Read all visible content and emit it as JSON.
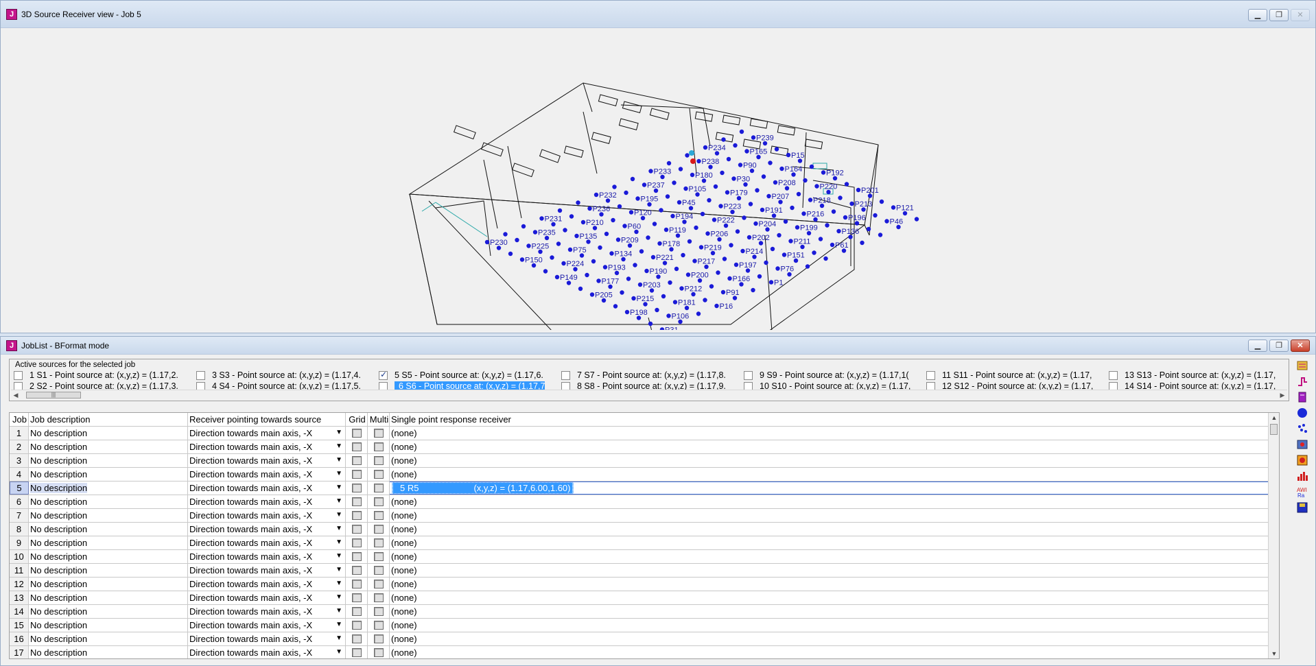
{
  "view_window": {
    "title": "3D Source Receiver view - Job 5",
    "icon": "app-logo-icon",
    "receiver_labels": [
      "P230",
      "P231",
      "P232",
      "P233",
      "P234",
      "P235",
      "P236",
      "P237",
      "P238",
      "P239",
      "P225",
      "P210",
      "P195",
      "P180",
      "P165",
      "P150",
      "P135",
      "P120",
      "P105",
      "P90",
      "P75",
      "P60",
      "P45",
      "P30",
      "P15",
      "P224",
      "P209",
      "P194",
      "P179",
      "P164",
      "P149",
      "P134",
      "P119",
      "P223",
      "P208",
      "P193",
      "P178",
      "P222",
      "P207",
      "P192",
      "P177",
      "P221",
      "P206",
      "P191",
      "P220",
      "P205",
      "P190",
      "P219",
      "P204",
      "P218",
      "P203",
      "P217",
      "P202",
      "P216",
      "P201",
      "P215",
      "P200",
      "P214",
      "P199",
      "P213",
      "P198",
      "P212",
      "P197",
      "P211",
      "P196",
      "P181",
      "P166",
      "P151",
      "P136",
      "P121",
      "P106",
      "P91",
      "P76",
      "P61",
      "P46",
      "P31",
      "P16",
      "P1"
    ]
  },
  "job_window": {
    "title": "JobList - BFormat mode",
    "icon": "app-logo-icon",
    "sources_caption": "Active sources for the selected job",
    "sources_row1": [
      {
        "label": "1 S1  -  Point source at: (x,y,z) = (1.17,2.",
        "checked": false,
        "selected": false
      },
      {
        "label": "3 S3  -  Point source at: (x,y,z) = (1.17,4.",
        "checked": false,
        "selected": false
      },
      {
        "label": "5 S5  -  Point source at: (x,y,z) = (1.17,6.",
        "checked": true,
        "selected": false
      },
      {
        "label": "7 S7  -  Point source at: (x,y,z) = (1.17,8.",
        "checked": false,
        "selected": false
      },
      {
        "label": "9 S9  -  Point source at: (x,y,z) = (1.17,1(",
        "checked": false,
        "selected": false
      },
      {
        "label": "11 S11  -  Point source at: (x,y,z) = (1.17,",
        "checked": false,
        "selected": false
      },
      {
        "label": "13 S13  -  Point source at: (x,y,z) = (1.17,",
        "checked": false,
        "selected": false
      }
    ],
    "sources_row2": [
      {
        "label": "2 S2  -  Point source at: (x,y,z) = (1.17,3.",
        "checked": false,
        "selected": false
      },
      {
        "label": "4 S4  -  Point source at: (x,y,z) = (1.17,5.",
        "checked": false,
        "selected": false
      },
      {
        "label": "6 S6  -  Point source at: (x,y,z) = (1.17,7",
        "checked": false,
        "selected": true
      },
      {
        "label": "8 S8  -  Point source at: (x,y,z) = (1.17,9.",
        "checked": false,
        "selected": false
      },
      {
        "label": "10 S10  -  Point source at: (x,y,z) = (1.17,",
        "checked": false,
        "selected": false
      },
      {
        "label": "12 S12  -  Point source at: (x,y,z) = (1.17,",
        "checked": false,
        "selected": false
      },
      {
        "label": "14 S14  -  Point source at: (x,y,z) = (1.17,",
        "checked": false,
        "selected": false
      }
    ],
    "grid": {
      "headers": {
        "job": "Job",
        "description": "Job description",
        "receiver": "Receiver pointing towards source",
        "grid": "Grid",
        "multi": "Multi",
        "single": "Single point response receiver"
      },
      "rows": [
        {
          "job": "1",
          "description": "No description",
          "receiver": "Direction towards main axis, -X",
          "single": "(none)"
        },
        {
          "job": "2",
          "description": "No description",
          "receiver": "Direction towards main axis, -X",
          "single": "(none)"
        },
        {
          "job": "3",
          "description": "No description",
          "receiver": "Direction towards main axis, -X",
          "single": "(none)"
        },
        {
          "job": "4",
          "description": "No description",
          "receiver": "Direction towards main axis, -X",
          "single": "(none)"
        },
        {
          "job": "5",
          "description": "No description",
          "receiver": "Direction towards main axis, -X",
          "single": "5 R5",
          "single_extra": "(x,y,z) = (1.17,6.00,1.60)",
          "selected": true
        },
        {
          "job": "6",
          "description": "No description",
          "receiver": "Direction towards main axis, -X",
          "single": "(none)"
        },
        {
          "job": "7",
          "description": "No description",
          "receiver": "Direction towards main axis, -X",
          "single": "(none)"
        },
        {
          "job": "8",
          "description": "No description",
          "receiver": "Direction towards main axis, -X",
          "single": "(none)"
        },
        {
          "job": "9",
          "description": "No description",
          "receiver": "Direction towards main axis, -X",
          "single": "(none)"
        },
        {
          "job": "10",
          "description": "No description",
          "receiver": "Direction towards main axis, -X",
          "single": "(none)"
        },
        {
          "job": "11",
          "description": "No description",
          "receiver": "Direction towards main axis, -X",
          "single": "(none)"
        },
        {
          "job": "12",
          "description": "No description",
          "receiver": "Direction towards main axis, -X",
          "single": "(none)"
        },
        {
          "job": "13",
          "description": "No description",
          "receiver": "Direction towards main axis, -X",
          "single": "(none)"
        },
        {
          "job": "14",
          "description": "No description",
          "receiver": "Direction towards main axis, -X",
          "single": "(none)"
        },
        {
          "job": "15",
          "description": "No description",
          "receiver": "Direction towards main axis, -X",
          "single": "(none)"
        },
        {
          "job": "16",
          "description": "No description",
          "receiver": "Direction towards main axis, -X",
          "single": "(none)"
        },
        {
          "job": "17",
          "description": "No description",
          "receiver": "Direction towards main axis, -X",
          "single": "(none)"
        }
      ]
    },
    "toolbar": [
      "edit-sources-icon",
      "line-response-icon",
      "book-icon",
      "sphere-icon",
      "scatter-icon",
      "grid-receivers-icon",
      "image-map-icon",
      "bar-chart-icon",
      "auralisation-icon",
      "save-icon"
    ]
  },
  "colors": {
    "receiver_dot": "#1a1ad8",
    "selection": "#3399ff",
    "title_bar": "#cad9ec"
  }
}
